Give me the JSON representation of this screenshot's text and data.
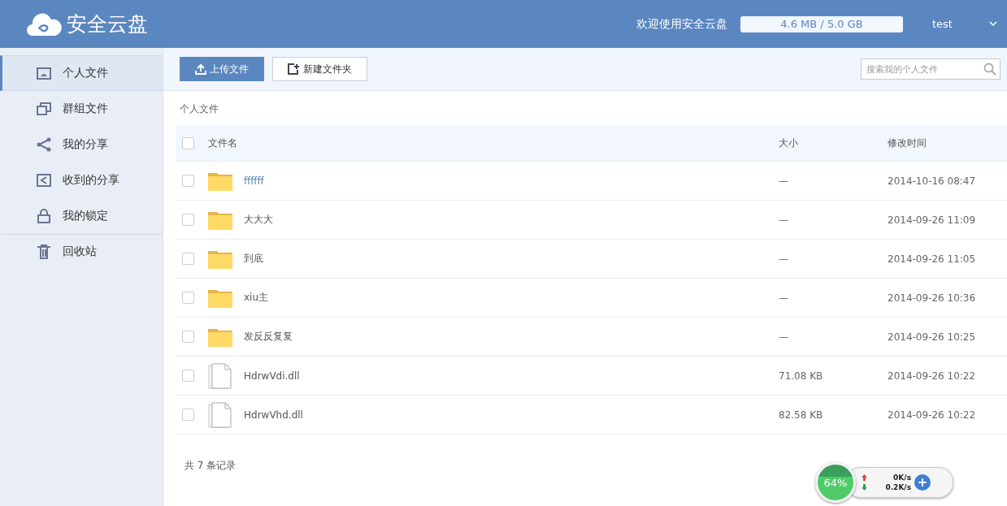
{
  "header": {
    "logo": "安全云盘",
    "welcome": "欢迎使用安全云盘",
    "quota": "4.6 MB / 5.0 GB",
    "user": "test"
  },
  "sidebar": {
    "items": [
      {
        "label": "个人文件",
        "selected": true
      },
      {
        "label": "群组文件",
        "selected": false
      },
      {
        "label": "我的分享",
        "selected": false
      },
      {
        "label": "收到的分享",
        "selected": false
      },
      {
        "label": "我的锁定",
        "selected": false
      },
      {
        "label": "回收站",
        "selected": false
      }
    ]
  },
  "toolbar": {
    "upload": "上传文件",
    "new_folder": "新建文件夹",
    "search": {
      "placeholder": "搜索我的个人文件"
    }
  },
  "breadcrumb": "个人文件",
  "table": {
    "select_all_checked": false,
    "columns": [
      "文件名",
      "大小",
      "修改时间"
    ],
    "rows": [
      {
        "kind": "folder",
        "name": "ffffff",
        "size": "—",
        "time": "2014-10-16 08:47",
        "checked": false,
        "hovered": true
      },
      {
        "kind": "folder",
        "name": "大大大",
        "size": "—",
        "time": "2014-09-26 11:09",
        "checked": false,
        "hovered": false
      },
      {
        "kind": "folder",
        "name": "到底",
        "size": "—",
        "time": "2014-09-26 11:05",
        "checked": false,
        "hovered": false
      },
      {
        "kind": "folder",
        "name": "xiu主",
        "size": "—",
        "time": "2014-09-26 10:36",
        "checked": false,
        "hovered": false
      },
      {
        "kind": "folder",
        "name": "发反反复复",
        "size": "—",
        "time": "2014-09-26 10:25",
        "checked": false,
        "hovered": false
      },
      {
        "kind": "file",
        "name": "HdrwVdi.dll",
        "size": "71.08 KB",
        "time": "2014-09-26 10:22",
        "checked": false,
        "hovered": false
      },
      {
        "kind": "file",
        "name": "HdrwVhd.dll",
        "size": "82.58 KB",
        "time": "2014-09-26 10:22",
        "checked": false,
        "hovered": false
      }
    ]
  },
  "record_count": "共 7 条记录",
  "speed_widget": {
    "percent": "64%",
    "upload": "0K/s",
    "download": "0.2K/s"
  }
}
